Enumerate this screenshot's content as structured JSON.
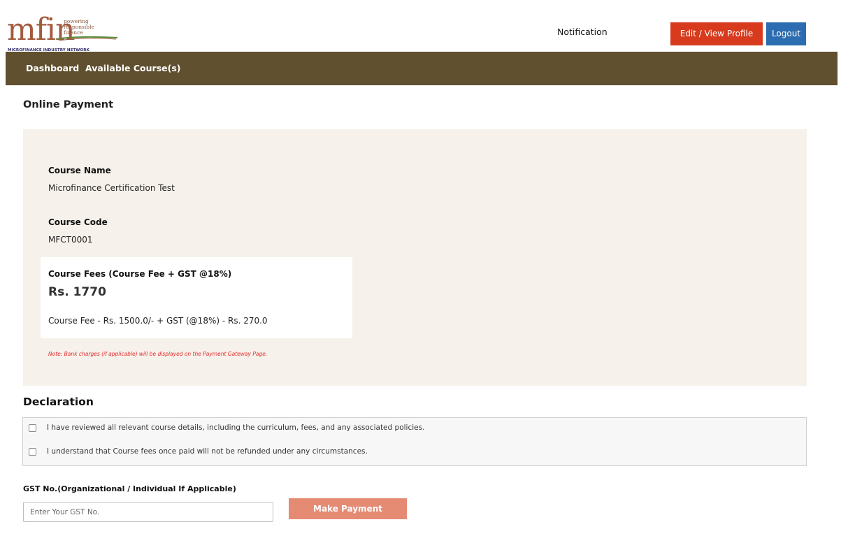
{
  "header": {
    "logo": {
      "brand": "mfin",
      "tagline_1": "powering",
      "tagline_2": "responsible",
      "tagline_3": "finance",
      "network": "MICROFINANCE INDUSTRY NETWORK"
    },
    "notification": "Notification",
    "profile_button": "Edit / View Profile",
    "logout_button": "Logout"
  },
  "nav": {
    "items": [
      {
        "label": "Dashboard"
      },
      {
        "label": "Available Course(s)"
      }
    ]
  },
  "page_title": "Online Payment",
  "course": {
    "name_label": "Course Name",
    "name_value": "Microfinance Certification Test",
    "code_label": "Course Code",
    "code_value": "MFCT0001",
    "fees_label": "Course Fees (Course Fee + GST @18%)",
    "fees_amount": "Rs. 1770",
    "fees_breakdown": "Course Fee - Rs. 1500.0/- + GST (@18%) - Rs. 270.0",
    "note": "Note: Bank charges (if applicable) will be displayed on the Payment Gateway Page."
  },
  "declaration": {
    "title": "Declaration",
    "items": [
      {
        "text": "I have reviewed all relevant course details, including the curriculum, fees, and any associated policies.",
        "checked": false
      },
      {
        "text": "I understand that Course fees once paid will not be refunded under any circumstances.",
        "checked": false
      }
    ]
  },
  "gst": {
    "label": "GST No.(Organizational / Individual If Applicable)",
    "placeholder": "Enter Your GST No.",
    "value": ""
  },
  "pay_button": "Make Payment",
  "colors": {
    "nav_bg": "#60502f",
    "profile_btn": "#d73a1c",
    "logout_btn": "#2c6cb0",
    "panel_bg": "#f6f1ea",
    "pay_btn": "#e58a73",
    "note_text": "#e32b2b",
    "logo": "#a35a3f"
  }
}
